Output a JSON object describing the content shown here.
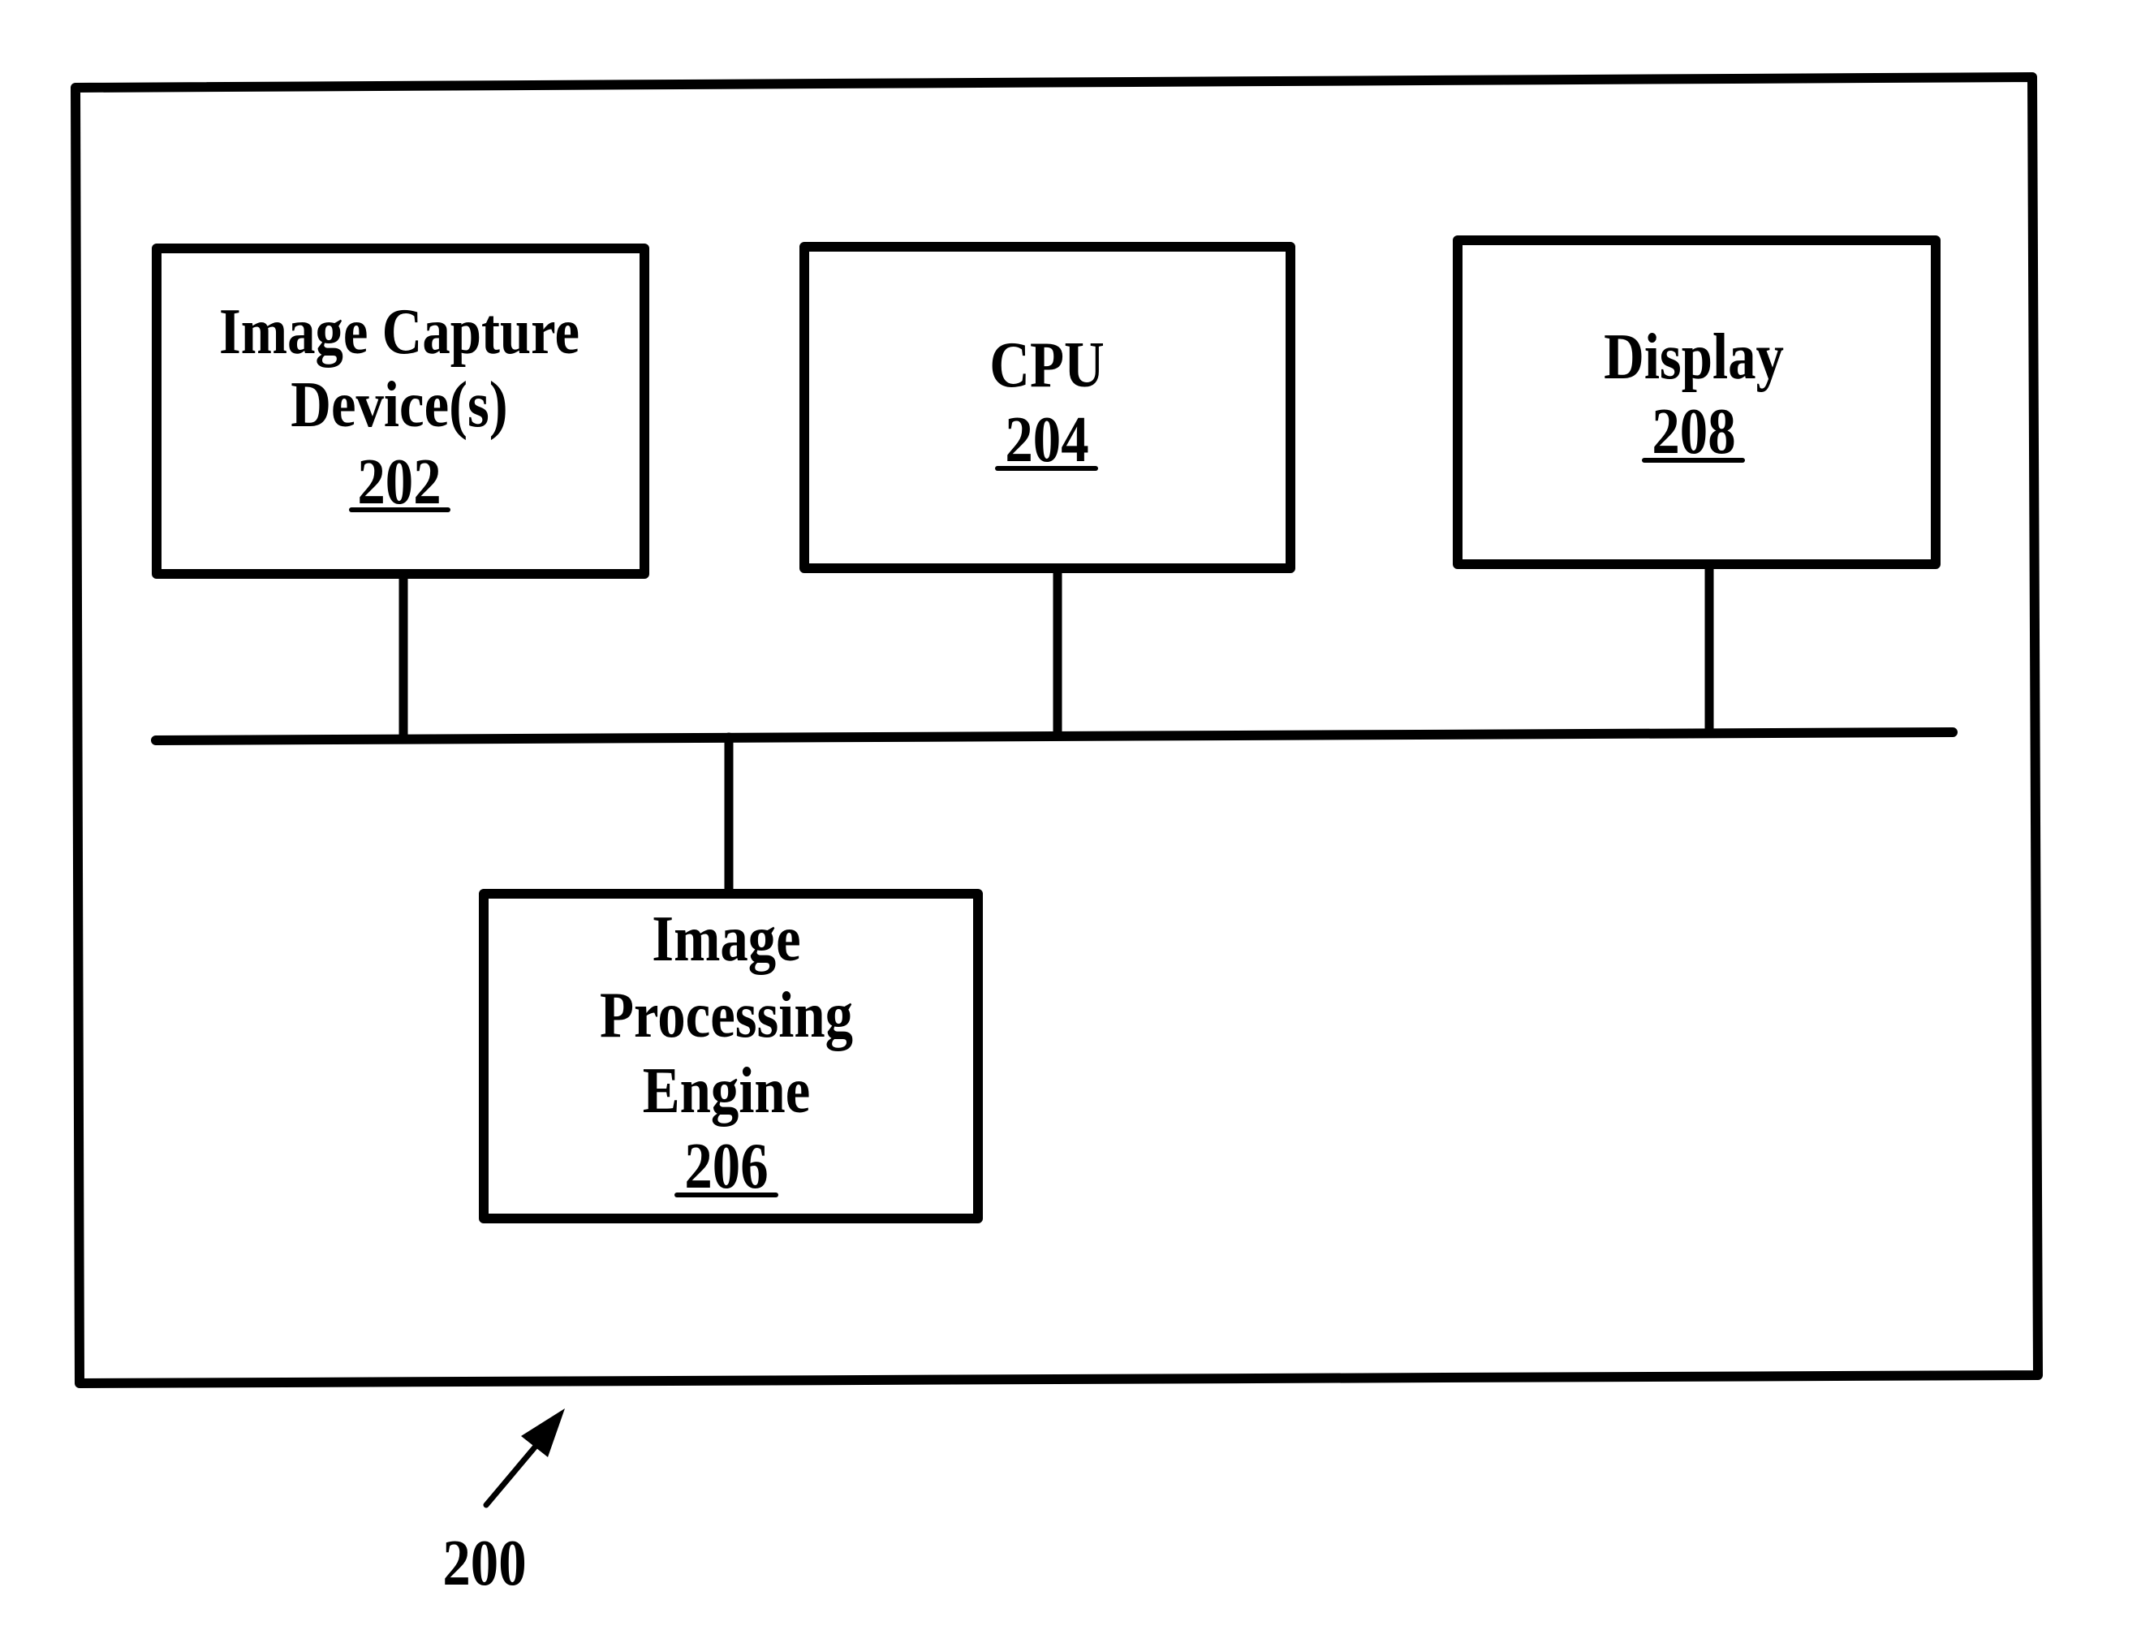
{
  "figure": {
    "reference_label": "200",
    "colors": {
      "ink": "#000000",
      "paper": "#ffffff"
    }
  },
  "blocks": {
    "image_capture": {
      "lines": [
        "Image Capture",
        "Device(s)"
      ],
      "ref": "202"
    },
    "cpu": {
      "lines": [
        "CPU"
      ],
      "ref": "204"
    },
    "image_processing": {
      "lines": [
        "Image",
        "Processing",
        "Engine"
      ],
      "ref": "206"
    },
    "display": {
      "lines": [
        "Display"
      ],
      "ref": "208"
    }
  },
  "connections": [
    {
      "from": "image_capture",
      "to": "bus"
    },
    {
      "from": "cpu",
      "to": "bus"
    },
    {
      "from": "display",
      "to": "bus"
    },
    {
      "from": "image_processing",
      "to": "bus"
    }
  ]
}
